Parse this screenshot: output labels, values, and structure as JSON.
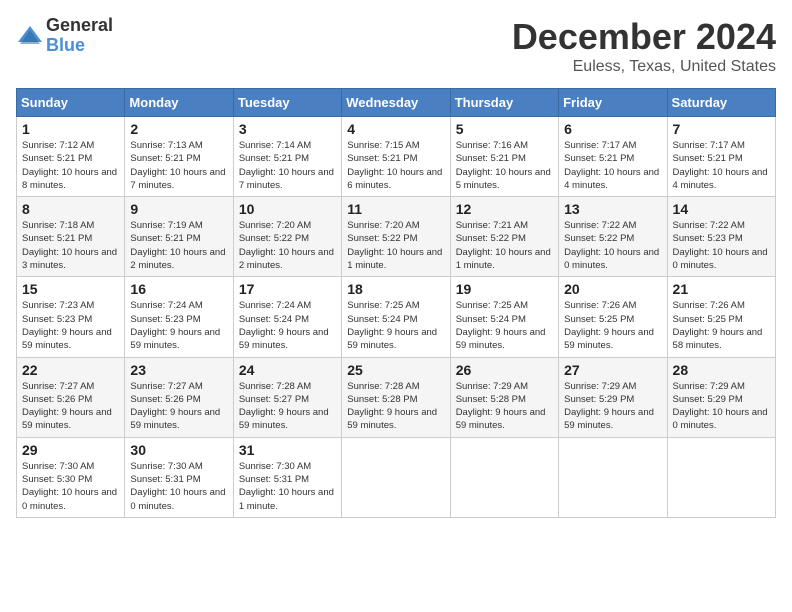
{
  "logo": {
    "general": "General",
    "blue": "Blue"
  },
  "title": "December 2024",
  "location": "Euless, Texas, United States",
  "days_of_week": [
    "Sunday",
    "Monday",
    "Tuesday",
    "Wednesday",
    "Thursday",
    "Friday",
    "Saturday"
  ],
  "weeks": [
    [
      {
        "day": "1",
        "sunrise": "Sunrise: 7:12 AM",
        "sunset": "Sunset: 5:21 PM",
        "daylight": "Daylight: 10 hours and 8 minutes."
      },
      {
        "day": "2",
        "sunrise": "Sunrise: 7:13 AM",
        "sunset": "Sunset: 5:21 PM",
        "daylight": "Daylight: 10 hours and 7 minutes."
      },
      {
        "day": "3",
        "sunrise": "Sunrise: 7:14 AM",
        "sunset": "Sunset: 5:21 PM",
        "daylight": "Daylight: 10 hours and 7 minutes."
      },
      {
        "day": "4",
        "sunrise": "Sunrise: 7:15 AM",
        "sunset": "Sunset: 5:21 PM",
        "daylight": "Daylight: 10 hours and 6 minutes."
      },
      {
        "day": "5",
        "sunrise": "Sunrise: 7:16 AM",
        "sunset": "Sunset: 5:21 PM",
        "daylight": "Daylight: 10 hours and 5 minutes."
      },
      {
        "day": "6",
        "sunrise": "Sunrise: 7:17 AM",
        "sunset": "Sunset: 5:21 PM",
        "daylight": "Daylight: 10 hours and 4 minutes."
      },
      {
        "day": "7",
        "sunrise": "Sunrise: 7:17 AM",
        "sunset": "Sunset: 5:21 PM",
        "daylight": "Daylight: 10 hours and 4 minutes."
      }
    ],
    [
      {
        "day": "8",
        "sunrise": "Sunrise: 7:18 AM",
        "sunset": "Sunset: 5:21 PM",
        "daylight": "Daylight: 10 hours and 3 minutes."
      },
      {
        "day": "9",
        "sunrise": "Sunrise: 7:19 AM",
        "sunset": "Sunset: 5:21 PM",
        "daylight": "Daylight: 10 hours and 2 minutes."
      },
      {
        "day": "10",
        "sunrise": "Sunrise: 7:20 AM",
        "sunset": "Sunset: 5:22 PM",
        "daylight": "Daylight: 10 hours and 2 minutes."
      },
      {
        "day": "11",
        "sunrise": "Sunrise: 7:20 AM",
        "sunset": "Sunset: 5:22 PM",
        "daylight": "Daylight: 10 hours and 1 minute."
      },
      {
        "day": "12",
        "sunrise": "Sunrise: 7:21 AM",
        "sunset": "Sunset: 5:22 PM",
        "daylight": "Daylight: 10 hours and 1 minute."
      },
      {
        "day": "13",
        "sunrise": "Sunrise: 7:22 AM",
        "sunset": "Sunset: 5:22 PM",
        "daylight": "Daylight: 10 hours and 0 minutes."
      },
      {
        "day": "14",
        "sunrise": "Sunrise: 7:22 AM",
        "sunset": "Sunset: 5:23 PM",
        "daylight": "Daylight: 10 hours and 0 minutes."
      }
    ],
    [
      {
        "day": "15",
        "sunrise": "Sunrise: 7:23 AM",
        "sunset": "Sunset: 5:23 PM",
        "daylight": "Daylight: 9 hours and 59 minutes."
      },
      {
        "day": "16",
        "sunrise": "Sunrise: 7:24 AM",
        "sunset": "Sunset: 5:23 PM",
        "daylight": "Daylight: 9 hours and 59 minutes."
      },
      {
        "day": "17",
        "sunrise": "Sunrise: 7:24 AM",
        "sunset": "Sunset: 5:24 PM",
        "daylight": "Daylight: 9 hours and 59 minutes."
      },
      {
        "day": "18",
        "sunrise": "Sunrise: 7:25 AM",
        "sunset": "Sunset: 5:24 PM",
        "daylight": "Daylight: 9 hours and 59 minutes."
      },
      {
        "day": "19",
        "sunrise": "Sunrise: 7:25 AM",
        "sunset": "Sunset: 5:24 PM",
        "daylight": "Daylight: 9 hours and 59 minutes."
      },
      {
        "day": "20",
        "sunrise": "Sunrise: 7:26 AM",
        "sunset": "Sunset: 5:25 PM",
        "daylight": "Daylight: 9 hours and 59 minutes."
      },
      {
        "day": "21",
        "sunrise": "Sunrise: 7:26 AM",
        "sunset": "Sunset: 5:25 PM",
        "daylight": "Daylight: 9 hours and 58 minutes."
      }
    ],
    [
      {
        "day": "22",
        "sunrise": "Sunrise: 7:27 AM",
        "sunset": "Sunset: 5:26 PM",
        "daylight": "Daylight: 9 hours and 59 minutes."
      },
      {
        "day": "23",
        "sunrise": "Sunrise: 7:27 AM",
        "sunset": "Sunset: 5:26 PM",
        "daylight": "Daylight: 9 hours and 59 minutes."
      },
      {
        "day": "24",
        "sunrise": "Sunrise: 7:28 AM",
        "sunset": "Sunset: 5:27 PM",
        "daylight": "Daylight: 9 hours and 59 minutes."
      },
      {
        "day": "25",
        "sunrise": "Sunrise: 7:28 AM",
        "sunset": "Sunset: 5:28 PM",
        "daylight": "Daylight: 9 hours and 59 minutes."
      },
      {
        "day": "26",
        "sunrise": "Sunrise: 7:29 AM",
        "sunset": "Sunset: 5:28 PM",
        "daylight": "Daylight: 9 hours and 59 minutes."
      },
      {
        "day": "27",
        "sunrise": "Sunrise: 7:29 AM",
        "sunset": "Sunset: 5:29 PM",
        "daylight": "Daylight: 9 hours and 59 minutes."
      },
      {
        "day": "28",
        "sunrise": "Sunrise: 7:29 AM",
        "sunset": "Sunset: 5:29 PM",
        "daylight": "Daylight: 10 hours and 0 minutes."
      }
    ],
    [
      {
        "day": "29",
        "sunrise": "Sunrise: 7:30 AM",
        "sunset": "Sunset: 5:30 PM",
        "daylight": "Daylight: 10 hours and 0 minutes."
      },
      {
        "day": "30",
        "sunrise": "Sunrise: 7:30 AM",
        "sunset": "Sunset: 5:31 PM",
        "daylight": "Daylight: 10 hours and 0 minutes."
      },
      {
        "day": "31",
        "sunrise": "Sunrise: 7:30 AM",
        "sunset": "Sunset: 5:31 PM",
        "daylight": "Daylight: 10 hours and 1 minute."
      },
      null,
      null,
      null,
      null
    ]
  ]
}
